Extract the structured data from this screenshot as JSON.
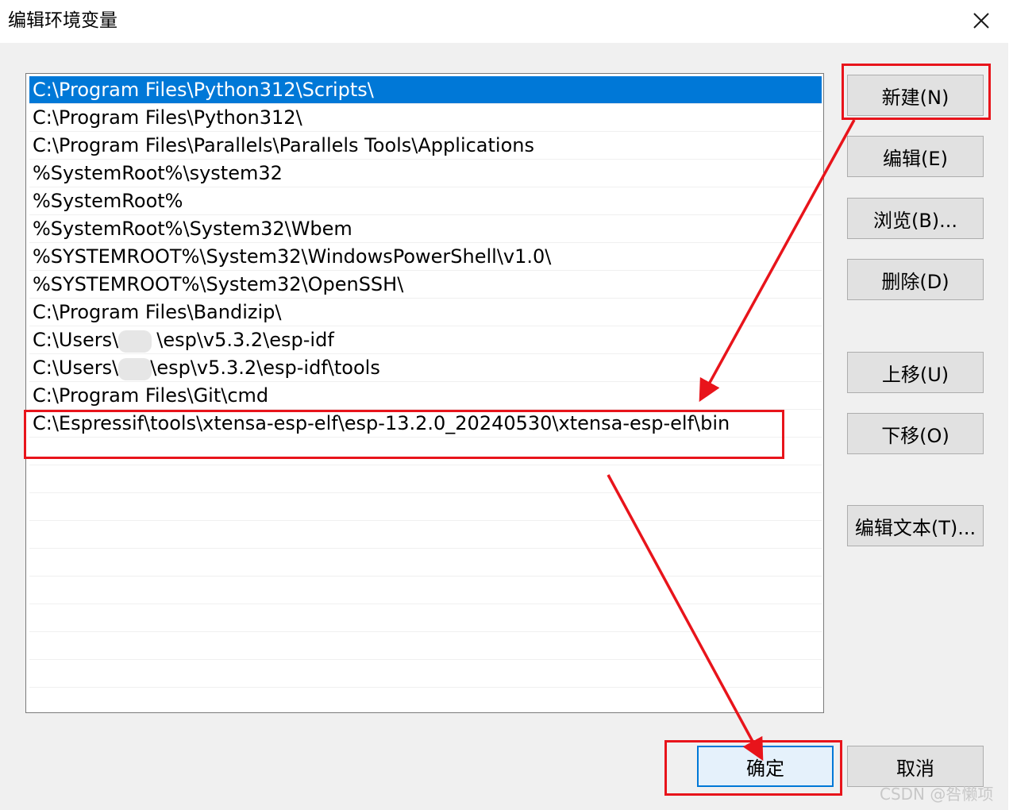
{
  "window": {
    "title": "编辑环境变量",
    "close_icon": "close-icon"
  },
  "path_list": {
    "items": [
      "C:\\Program Files\\Python312\\Scripts\\",
      "C:\\Program Files\\Python312\\",
      "C:\\Program Files\\Parallels\\Parallels Tools\\Applications",
      "%SystemRoot%\\system32",
      "%SystemRoot%",
      "%SystemRoot%\\System32\\Wbem",
      "%SYSTEMROOT%\\System32\\WindowsPowerShell\\v1.0\\",
      "%SYSTEMROOT%\\System32\\OpenSSH\\",
      "C:\\Program Files\\Bandizip\\",
      "C:\\Users\\",
      "C:\\Users\\",
      "C:\\Program Files\\Git\\cmd",
      "C:\\Espressif\\tools\\xtensa-esp-elf\\esp-13.2.0_20240530\\xtensa-esp-elf\\bin"
    ],
    "item_suffixes": {
      "item_9": "\\esp\\v5.3.2\\esp-idf",
      "item_10": "\\esp\\v5.3.2\\esp-idf\\tools"
    },
    "selected_index": 0
  },
  "buttons": {
    "new": "新建(N)",
    "edit": "编辑(E)",
    "browse": "浏览(B)...",
    "delete": "删除(D)",
    "move_up": "上移(U)",
    "move_down": "下移(O)",
    "edit_text": "编辑文本(T)...",
    "ok": "确定",
    "cancel": "取消"
  },
  "annotations": {
    "highlight_color": "#e8141b",
    "selection_color": "#0078d7"
  },
  "watermark": "CSDN @咎懒项"
}
